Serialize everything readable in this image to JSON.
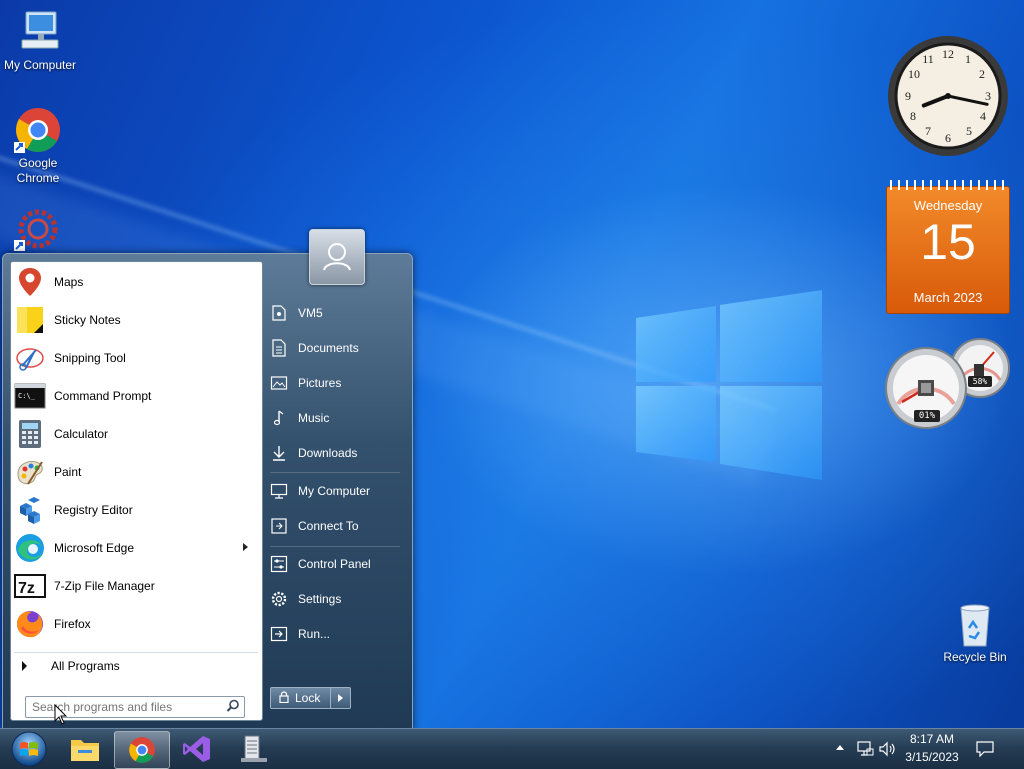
{
  "desktop": {
    "icons": [
      {
        "label": "My Computer",
        "icon": "computer-icon"
      },
      {
        "label": "Google Chrome",
        "icon": "chrome-icon"
      },
      {
        "label": "",
        "icon": "settings-gear-icon"
      },
      {
        "label": "Recycle Bin",
        "icon": "recycle-bin-icon"
      }
    ]
  },
  "gadgets": {
    "clock": {
      "hour": 8,
      "minute": 17
    },
    "calendar": {
      "weekday": "Wednesday",
      "day": "15",
      "month_year": "March 2023"
    },
    "meters": {
      "cpu": "01%",
      "memory": "58%"
    }
  },
  "start_menu": {
    "programs": [
      {
        "label": "Maps",
        "icon": "maps-icon"
      },
      {
        "label": "Sticky Notes",
        "icon": "sticky-notes-icon"
      },
      {
        "label": "Snipping Tool",
        "icon": "snipping-tool-icon"
      },
      {
        "label": "Command Prompt",
        "icon": "command-prompt-icon"
      },
      {
        "label": "Calculator",
        "icon": "calculator-icon"
      },
      {
        "label": "Paint",
        "icon": "paint-icon"
      },
      {
        "label": "Registry Editor",
        "icon": "registry-editor-icon"
      },
      {
        "label": "Microsoft Edge",
        "icon": "edge-icon",
        "submenu": true
      },
      {
        "label": "7-Zip File Manager",
        "icon": "7zip-icon"
      },
      {
        "label": "Firefox",
        "icon": "firefox-icon"
      }
    ],
    "all_programs": "All Programs",
    "search_placeholder": "Search programs and files",
    "right_items": [
      {
        "label": "VM5",
        "icon": "user-folder-icon"
      },
      {
        "label": "Documents",
        "icon": "document-icon"
      },
      {
        "label": "Pictures",
        "icon": "pictures-icon"
      },
      {
        "label": "Music",
        "icon": "music-icon"
      },
      {
        "label": "Downloads",
        "icon": "download-icon"
      },
      {
        "label": "My Computer",
        "icon": "computer-icon"
      },
      {
        "label": "Connect To",
        "icon": "connect-icon"
      },
      {
        "label": "Control Panel",
        "icon": "control-panel-icon"
      },
      {
        "label": "Settings",
        "icon": "gear-icon"
      },
      {
        "label": "Run...",
        "icon": "run-icon"
      }
    ],
    "lock_label": "Lock"
  },
  "taskbar": {
    "time": "8:17 AM",
    "date": "3/15/2023",
    "pinned": [
      "start-orb-icon",
      "file-explorer-icon",
      "chrome-icon",
      "visual-studio-icon",
      "server-manager-icon"
    ]
  },
  "colors": {
    "calendar": "#e8650f",
    "start_panel": "#2a4560",
    "taskbar": "#243b52"
  }
}
